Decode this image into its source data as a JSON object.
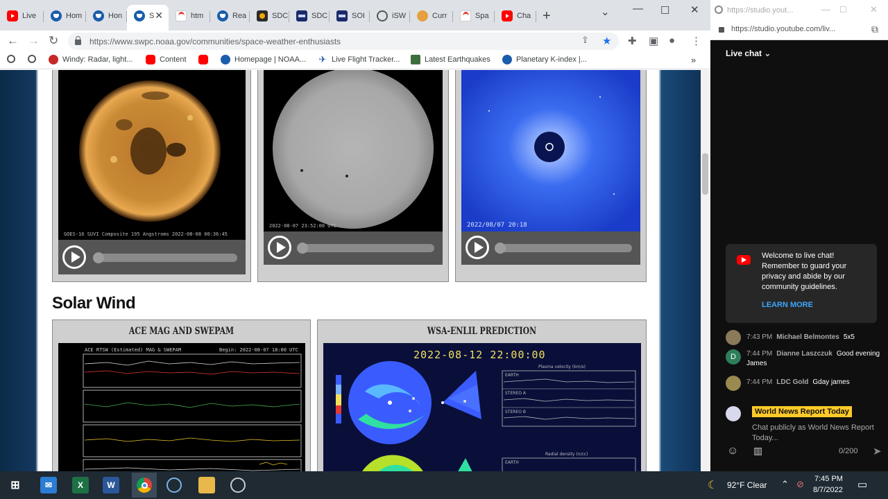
{
  "tabs": [
    {
      "label": "Live",
      "icon": "yt"
    },
    {
      "label": "Hom",
      "icon": "noaa"
    },
    {
      "label": "Hon",
      "icon": "noaa"
    },
    {
      "label": "S",
      "icon": "noaa"
    },
    {
      "label": "htm",
      "icon": "hm"
    },
    {
      "label": "Rea",
      "icon": "noaa"
    },
    {
      "label": "SDC",
      "icon": "sdo"
    },
    {
      "label": "SDC",
      "icon": "sdo2"
    },
    {
      "label": "SOI",
      "icon": "sdo2"
    },
    {
      "label": "iSW",
      "icon": "globe"
    },
    {
      "label": "Curr",
      "icon": "sun"
    },
    {
      "label": "Spa",
      "icon": "hm"
    },
    {
      "label": "Cha",
      "icon": "yt"
    }
  ],
  "address": {
    "url": "https://www.swpc.noaa.gov/communities/space-weather-enthusiasts"
  },
  "bookmarks": [
    {
      "label": "",
      "icon": "globe"
    },
    {
      "label": "",
      "icon": "globe"
    },
    {
      "label": "Windy: Radar, light...",
      "icon": "hm"
    },
    {
      "label": "Content",
      "icon": "yt"
    },
    {
      "label": "",
      "icon": "yt"
    },
    {
      "label": "Homepage | NOAA...",
      "icon": "noaa"
    },
    {
      "label": "Live Flight Tracker...",
      "icon": "plane"
    },
    {
      "label": "Latest Earthquakes",
      "icon": "quake"
    },
    {
      "label": "Planetary K-index |...",
      "icon": "noaa"
    }
  ],
  "page": {
    "captions": {
      "suvi": "GOES-16 SUVI Composite 195 Angstroms 2022-08-08 00:36:45",
      "hmi": "2022-08-07 23:52:00 UTC",
      "lasco": "2022/08/07 20:18"
    },
    "section_title": "Solar Wind",
    "ace_title": "ACE MAG AND SWEPAM",
    "ace_plot": {
      "left": "ACE RTSW (Estimated) MAG & SWEPAM",
      "right": "Begin: 2022-08-07 18:00 UTC"
    },
    "enlil_title": "WSA-ENLIL PREDICTION",
    "enlil_time": "2022-08-12 22:00:00",
    "enlil_labels": {
      "top_plot": "Plasma velocity (km/s)",
      "earth": "EARTH",
      "stereo_a": "STEREO A",
      "stereo_b": "STEREO B",
      "bottom_plot": "Radial density (n/cc)",
      "earth_bottom": "EARTH"
    }
  },
  "yt": {
    "url_faded": "https://studio.yout...",
    "url": "https://studio.youtube.com/liv...",
    "chat_header": "Live chat",
    "welcome": "Welcome to live chat! Remember to guard your privacy and abide by our community guidelines.",
    "learn_more": "LEARN MORE",
    "messages": [
      {
        "time": "7:43 PM",
        "name": "Michael Belmontes",
        "text": "5x5",
        "avatar": "",
        "avatar_color": "#8a7a5a"
      },
      {
        "time": "7:44 PM",
        "name": "Dianne Laszczuk",
        "text": "Good evening James",
        "avatar": "D",
        "avatar_color": "#2e7d5b"
      },
      {
        "time": "7:44 PM",
        "name": "LDC Gold",
        "text": "Gday james",
        "avatar": "",
        "avatar_color": "#9a8a50"
      }
    ],
    "channel_chip": "World News Report Today",
    "compose_hint": "Chat publicly as World News Report Today...",
    "char_count": "0/200"
  },
  "taskbar": {
    "weather": "92°F  Clear",
    "time": "7:45 PM",
    "date": "8/7/2022"
  }
}
